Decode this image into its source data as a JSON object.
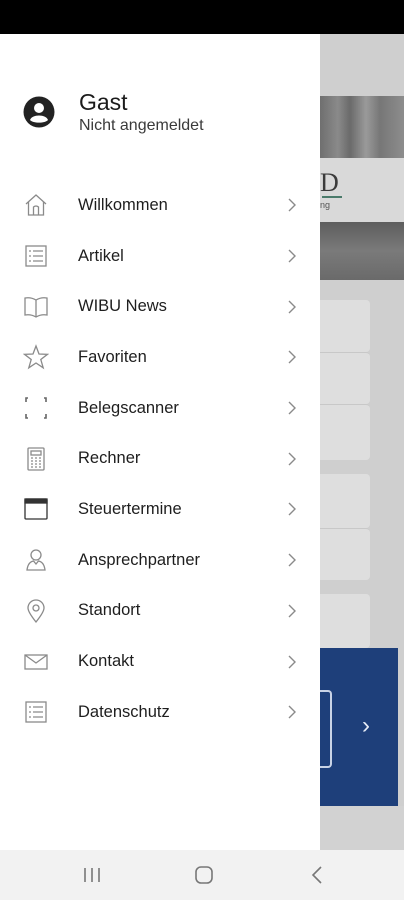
{
  "user": {
    "name": "Gast",
    "status": "Nicht angemeldet",
    "avatar_icon": "account-circle-icon"
  },
  "menu": [
    {
      "label": "Willkommen",
      "icon": "home-icon"
    },
    {
      "label": "Artikel",
      "icon": "article-list-icon"
    },
    {
      "label": "WIBU News",
      "icon": "open-book-icon"
    },
    {
      "label": "Favoriten",
      "icon": "star-icon"
    },
    {
      "label": "Belegscanner",
      "icon": "scan-frame-icon"
    },
    {
      "label": "Rechner",
      "icon": "calculator-icon"
    },
    {
      "label": "Steuertermine",
      "icon": "calendar-icon"
    },
    {
      "label": "Ansprechpartner",
      "icon": "person-icon"
    },
    {
      "label": "Standort",
      "icon": "location-pin-icon"
    },
    {
      "label": "Kontakt",
      "icon": "envelope-icon"
    },
    {
      "label": "Datenschutz",
      "icon": "document-list-icon"
    }
  ],
  "background": {
    "logo_letter": "D",
    "logo_subtext": "ng"
  },
  "colors": {
    "drawer_bg": "#ffffff",
    "banner_blue": "#1e3f7a",
    "icon_gray": "#8a8a8a",
    "status_bar": "#000000"
  },
  "nav": [
    "recent-apps-icon",
    "home-button-icon",
    "back-icon"
  ]
}
